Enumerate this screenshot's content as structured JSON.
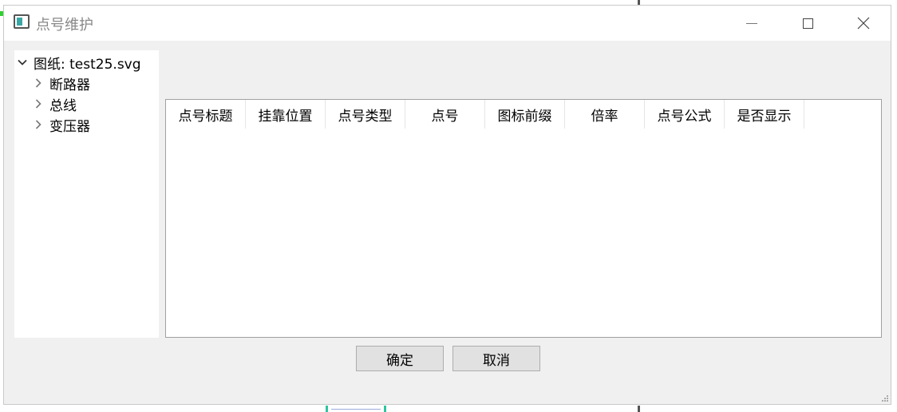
{
  "window": {
    "title": "点号维护"
  },
  "titlebar_buttons": {
    "minimize": "minimize-icon",
    "maximize": "maximize-icon",
    "close": "close-icon"
  },
  "tree": {
    "root": {
      "label": "图纸: test25.svg",
      "expanded": true
    },
    "children": [
      {
        "label": "断路器",
        "expanded": false
      },
      {
        "label": "总线",
        "expanded": false
      },
      {
        "label": "变压器",
        "expanded": false
      }
    ]
  },
  "table": {
    "columns": [
      "点号标题",
      "挂靠位置",
      "点号类型",
      "点号",
      "图标前缀",
      "倍率",
      "点号公式",
      "是否显示"
    ],
    "rows": []
  },
  "buttons": {
    "ok_label": "确定",
    "cancel_label": "取消"
  }
}
